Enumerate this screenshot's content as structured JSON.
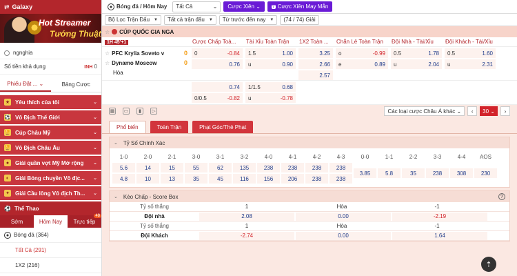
{
  "sidebar": {
    "galaxy_label": "Galaxy",
    "banner_line1": "Hot Streamer",
    "banner_line2": "Tướng Thuật",
    "username": "ngnghia",
    "balance_label": "Số tiền khả dụng",
    "balance_currency": "INH",
    "balance_value": "0",
    "slip_tabs": [
      "Phiếu Đặt ...",
      "Bảng Cược"
    ],
    "menu": [
      {
        "label": "Yêu thích của tôi",
        "icon": "star-icon"
      },
      {
        "label": "Vô Địch Thế Giới",
        "icon": "football-icon"
      },
      {
        "label": "Cúp Châu Mỹ",
        "icon": "trophy-icon"
      },
      {
        "label": "Vô Địch Châu Âu",
        "icon": "trophy-icon"
      },
      {
        "label": "Giải quần vợt Mỹ Mở rộng",
        "icon": "tennis-icon"
      },
      {
        "label": "Giải Bóng chuyền Vô địc...",
        "icon": "volleyball-icon"
      },
      {
        "label": "Giải Cầu lông Vô địch Th...",
        "icon": "badminton-icon"
      }
    ],
    "sports_label": "Thể Thao",
    "sports_tabs": [
      "Sớm",
      "Hôm Nay",
      "Trực tiếp"
    ],
    "sports_badge": "48",
    "sport_football": "Bóng đá",
    "sport_football_count": "(364)",
    "sub_all": "Tất Cả",
    "sub_all_count": "(291)",
    "sub_1x2": "1X2",
    "sub_1x2_count": "(216)"
  },
  "topbar": {
    "sport_label": "Bóng đá / Hôm Nay",
    "all_label": "Tất Cả",
    "parlay_label": "Cược Xiên",
    "lucky_label": "Cược Xiên May Mắn"
  },
  "filters": {
    "match_filter": "Bộ Lọc Trận Đấu",
    "all_matches": "Tất cả trận đấu",
    "sort": "Từ trước đến nay",
    "count": "(74 / 74) Giải"
  },
  "league": {
    "name": "CÚP QUỐC GIA NGA"
  },
  "table": {
    "live_badge": "1H  45'+1",
    "headers": [
      "Cược Chấp Toà...",
      "Tài Xỉu Toàn Trận",
      "1X2 Toàn ...",
      "Chẵn Lẻ Toàn Trận",
      "Đội Nhà - Tài/Xỉu",
      "Đội Khách - Tài/Xỉu"
    ],
    "home_team": "PFC Krylia Soveto v",
    "away_team": "Dynamo Moscow",
    "draw_label": "Hòa",
    "home_score": "0",
    "away_score": "0",
    "hdp_main": {
      "line": "0",
      "home": "-0.84",
      "away": "0.76"
    },
    "ou_main": {
      "line": "1.5",
      "over": "1.00",
      "under_label": "u",
      "under": "0.90"
    },
    "x12": {
      "home": "3.25",
      "away": "2.66",
      "draw": "2.57"
    },
    "oe": {
      "odd_label": "o",
      "odd": "-0.99",
      "even_label": "e",
      "even": "0.89"
    },
    "home_ou": {
      "line": "0.5",
      "over": "1.78",
      "under_label": "u",
      "under": "2.04"
    },
    "away_ou": {
      "line": "0.5",
      "over": "1.60",
      "under_label": "u",
      "under": "2.31"
    },
    "hdp_alt": {
      "line_top": "",
      "home": "0.74",
      "line": "0/0.5",
      "away": "-0.82"
    },
    "ou_alt": {
      "line": "1/1.5",
      "over": "0.68",
      "under_label": "u",
      "under": "-0.78"
    }
  },
  "toolbar": {
    "bet_type_select": "Các loại cược Châu Á khác",
    "refresh_count": "30"
  },
  "market_tabs": [
    "Phổ biến",
    "Toàn Trận",
    "Phạt Góc/Thẻ Phạt"
  ],
  "correct_score": {
    "title": "Tỷ Số Chính Xác",
    "labels": [
      "1-0",
      "2-0",
      "2-1",
      "3-0",
      "3-1",
      "3-2",
      "4-0",
      "4-1",
      "4-2",
      "4-3",
      "0-0",
      "1-1",
      "2-2",
      "3-3",
      "4-4",
      "AOS"
    ],
    "row1": [
      "5.6",
      "14",
      "15",
      "55",
      "62",
      "135",
      "238",
      "238",
      "238",
      "238"
    ],
    "row2": [
      "4.8",
      "10",
      "13",
      "35",
      "45",
      "116",
      "156",
      "206",
      "238",
      "238"
    ],
    "draws": [
      "3.85",
      "5.8",
      "35",
      "238",
      "308",
      "230"
    ]
  },
  "score_box": {
    "title": "Kèo Chấp - Score Box",
    "win_margin_label": "Tỷ số thắng",
    "home_label": "Đội nhà",
    "away_label": "Đội Khách",
    "cols": [
      "1",
      "Hòa",
      "-1"
    ],
    "home_odds": [
      "2.08",
      "0.00",
      "-2.19"
    ],
    "away_odds": [
      "-2.74",
      "0.00",
      "1.64"
    ]
  }
}
